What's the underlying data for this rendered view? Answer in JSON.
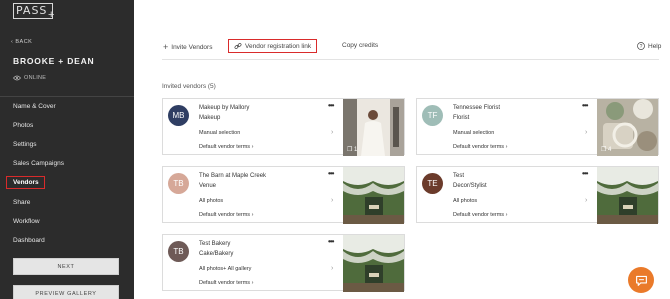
{
  "sidebar": {
    "logo": "PASS",
    "back": "BACK",
    "gallery_title": "BROOKE + DEAN",
    "status": "ONLINE",
    "nav": [
      "Name & Cover",
      "Photos",
      "Settings",
      "Sales Campaigns",
      "Vendors",
      "Share",
      "Workflow",
      "Dashboard"
    ],
    "active": "Vendors",
    "next_button": "NEXT",
    "preview_button": "PREVIEW GALLERY"
  },
  "toolbar": {
    "invite": "Invite Vendors",
    "registration": "Vendor registration link",
    "copy": "Copy credits",
    "help": "Help"
  },
  "section_title": "Invited vendors (5)",
  "vendors": [
    {
      "initials": "MB",
      "name": "Makeup by Mallory",
      "category": "Makeup",
      "selection": "Manual selection",
      "terms": "Default vendor terms",
      "avatar_color": "#2f3e63",
      "thumb_badge": "1"
    },
    {
      "initials": "TF",
      "name": "Tennessee Florist",
      "category": "Florist",
      "selection": "Manual selection",
      "terms": "Default vendor terms",
      "avatar_color": "#9fbdb7",
      "thumb_badge": "4"
    },
    {
      "initials": "TB",
      "name": "The Barn at Maple Creek",
      "category": "Venue",
      "selection": "All photos",
      "terms": "Default vendor terms",
      "avatar_color": "#d6a898"
    },
    {
      "initials": "TE",
      "name": "Test",
      "category": "Decor/Stylist",
      "selection": "All photos",
      "terms": "Default vendor terms",
      "avatar_color": "#6b3b2b"
    },
    {
      "initials": "TB",
      "name": "Test Bakery",
      "category": "Cake/Bakery",
      "selection": "All photos+ All gallery",
      "terms": "Default vendor terms",
      "avatar_color": "#6e5a57"
    }
  ],
  "colors": {
    "sidebar_bg": "#2c2c2c",
    "highlight": "#d92b2b",
    "chat_button": "#ea7a2a"
  }
}
